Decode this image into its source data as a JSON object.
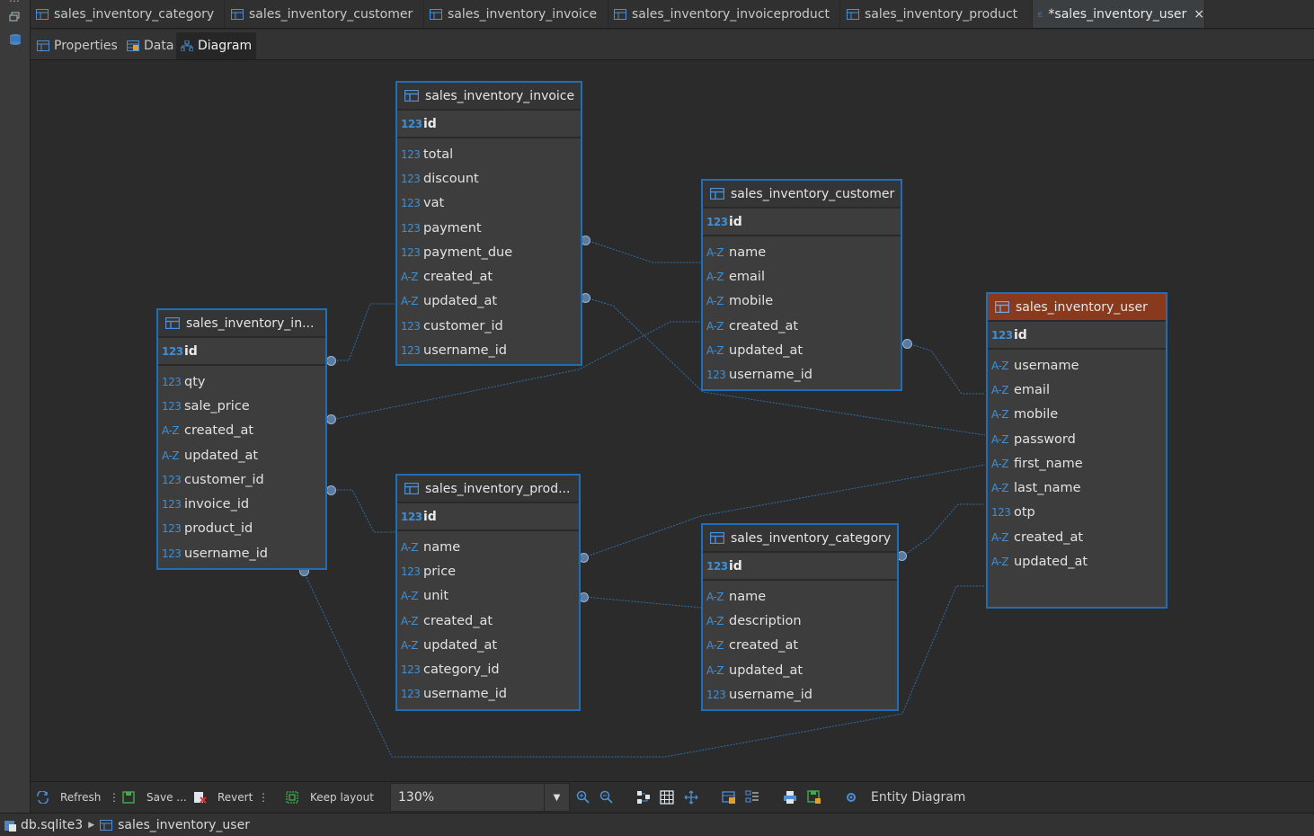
{
  "editor_tabs": [
    {
      "label": "sales_inventory_category",
      "active": false
    },
    {
      "label": "sales_inventory_customer",
      "active": false
    },
    {
      "label": "sales_inventory_invoice",
      "active": false
    },
    {
      "label": "sales_inventory_invoiceproduct",
      "active": false
    },
    {
      "label": "sales_inventory_product",
      "active": false
    },
    {
      "label": "*sales_inventory_user",
      "active": true,
      "close": "×"
    }
  ],
  "sub_tabs": [
    {
      "label": "Properties",
      "icon": "table-icon"
    },
    {
      "label": "Data",
      "icon": "data-grid-icon"
    },
    {
      "label": "Diagram",
      "icon": "diagram-icon",
      "active": true
    }
  ],
  "entities": {
    "invoice": {
      "title": "sales_inventory_invoice",
      "pk": {
        "type": "123",
        "name": "id"
      },
      "columns": [
        {
          "type": "123",
          "name": "total"
        },
        {
          "type": "123",
          "name": "discount"
        },
        {
          "type": "123",
          "name": "vat"
        },
        {
          "type": "123",
          "name": "payment"
        },
        {
          "type": "123",
          "name": "payment_due"
        },
        {
          "type": "A-Z",
          "name": "created_at"
        },
        {
          "type": "A-Z",
          "name": "updated_at"
        },
        {
          "type": "123",
          "name": "customer_id"
        },
        {
          "type": "123",
          "name": "username_id"
        }
      ]
    },
    "customer": {
      "title": "sales_inventory_customer",
      "pk": {
        "type": "123",
        "name": "id"
      },
      "columns": [
        {
          "type": "A-Z",
          "name": "name"
        },
        {
          "type": "A-Z",
          "name": "email"
        },
        {
          "type": "A-Z",
          "name": "mobile"
        },
        {
          "type": "A-Z",
          "name": "created_at"
        },
        {
          "type": "A-Z",
          "name": "updated_at"
        },
        {
          "type": "123",
          "name": "username_id"
        }
      ]
    },
    "invoiceproduct": {
      "title": "sales_inventory_in...",
      "pk": {
        "type": "123",
        "name": "id"
      },
      "columns": [
        {
          "type": "123",
          "name": "qty"
        },
        {
          "type": "123",
          "name": "sale_price"
        },
        {
          "type": "A-Z",
          "name": "created_at"
        },
        {
          "type": "A-Z",
          "name": "updated_at"
        },
        {
          "type": "123",
          "name": "customer_id"
        },
        {
          "type": "123",
          "name": "invoice_id"
        },
        {
          "type": "123",
          "name": "product_id"
        },
        {
          "type": "123",
          "name": "username_id"
        }
      ]
    },
    "user": {
      "title": "sales_inventory_user",
      "pk": {
        "type": "123",
        "name": "id"
      },
      "columns": [
        {
          "type": "A-Z",
          "name": "username"
        },
        {
          "type": "A-Z",
          "name": "email"
        },
        {
          "type": "A-Z",
          "name": "mobile"
        },
        {
          "type": "A-Z",
          "name": "password"
        },
        {
          "type": "A-Z",
          "name": "first_name"
        },
        {
          "type": "A-Z",
          "name": "last_name"
        },
        {
          "type": "123",
          "name": "otp"
        },
        {
          "type": "A-Z",
          "name": "created_at"
        },
        {
          "type": "A-Z",
          "name": "updated_at"
        }
      ]
    },
    "product": {
      "title": "sales_inventory_prod...",
      "pk": {
        "type": "123",
        "name": "id"
      },
      "columns": [
        {
          "type": "A-Z",
          "name": "name"
        },
        {
          "type": "123",
          "name": "price"
        },
        {
          "type": "A-Z",
          "name": "unit"
        },
        {
          "type": "A-Z",
          "name": "created_at"
        },
        {
          "type": "A-Z",
          "name": "updated_at"
        },
        {
          "type": "123",
          "name": "category_id"
        },
        {
          "type": "123",
          "name": "username_id"
        }
      ]
    },
    "category": {
      "title": "sales_inventory_category",
      "pk": {
        "type": "123",
        "name": "id"
      },
      "columns": [
        {
          "type": "A-Z",
          "name": "name"
        },
        {
          "type": "A-Z",
          "name": "description"
        },
        {
          "type": "A-Z",
          "name": "created_at"
        },
        {
          "type": "A-Z",
          "name": "updated_at"
        },
        {
          "type": "123",
          "name": "username_id"
        }
      ]
    }
  },
  "toolbar": {
    "refresh": "Refresh",
    "save": "Save ...",
    "revert": "Revert",
    "keep_layout": "Keep layout",
    "zoom": "130%",
    "entity_diagram": "Entity Diagram"
  },
  "status": {
    "db": "db.sqlite3",
    "table": "sales_inventory_user"
  },
  "colors": {
    "entity_border": "#1e6fb8",
    "selected_header": "#8a3a1c",
    "type_badge": "#3f8fd6"
  }
}
